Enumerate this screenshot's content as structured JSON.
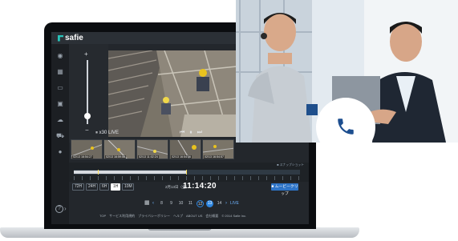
{
  "app": {
    "logo": "safie"
  },
  "controls": {
    "zoom_plus": "+",
    "zoom_minus": "−",
    "speed": "x30",
    "live": "LIVE",
    "transport": "⏮ ⏸ ⏭"
  },
  "thumbnails": [
    {
      "caption": "02/13 16:54:27"
    },
    {
      "caption": "02/13 16:59:56"
    },
    {
      "caption": "02/13 11:02:24"
    },
    {
      "caption": "02/13 16:54:36"
    },
    {
      "caption": "02/13 16:54:57"
    }
  ],
  "timeline": {
    "label": "■ スナップショット"
  },
  "range_buttons": [
    "72H",
    "24H",
    "6H",
    "1H",
    "10M"
  ],
  "range_active": "1H",
  "datetime": {
    "date": "2月13日（金）",
    "time": "11:14:20"
  },
  "clip_button": "■ ムービークリップ",
  "pager": {
    "days": [
      "8",
      "9",
      "10",
      "11",
      "12",
      "13",
      "14"
    ],
    "active_day": "13",
    "live": "LIVE"
  },
  "footer": "TOP　サービス利用規約　プライバシーポリシー　ヘルプ　ABOUT US　会社概要　© 2014 Safie Inc.",
  "colors": {
    "accent_blue": "#2e86e0",
    "brand_teal": "#27c3b9",
    "phone_blue": "#1d4e8f"
  }
}
